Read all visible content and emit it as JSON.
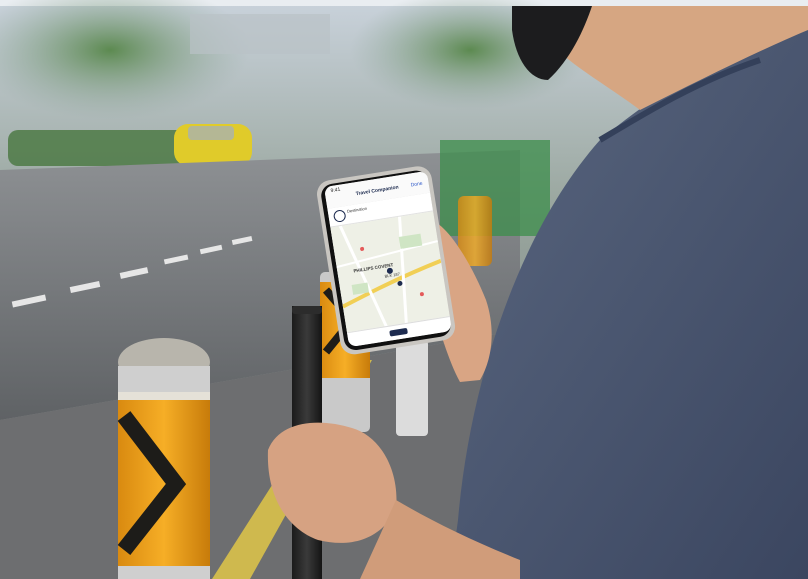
{
  "scene": {
    "description_colors": {
      "sky": "#cfd6df",
      "shirt": "#4b5872",
      "bollard_orange": "#f0a21a",
      "bollard_black": "#1d1c19",
      "taxi_yellow": "#e4cf2a",
      "skin": "#d7a37f"
    }
  },
  "phone": {
    "status_time": "9:41",
    "screen_title": "Travel Companion",
    "done_label": "Done",
    "info_text": "Destination",
    "map_label_primary": "PHILLIPS COVENT",
    "map_label_secondary": "BLK 187"
  }
}
